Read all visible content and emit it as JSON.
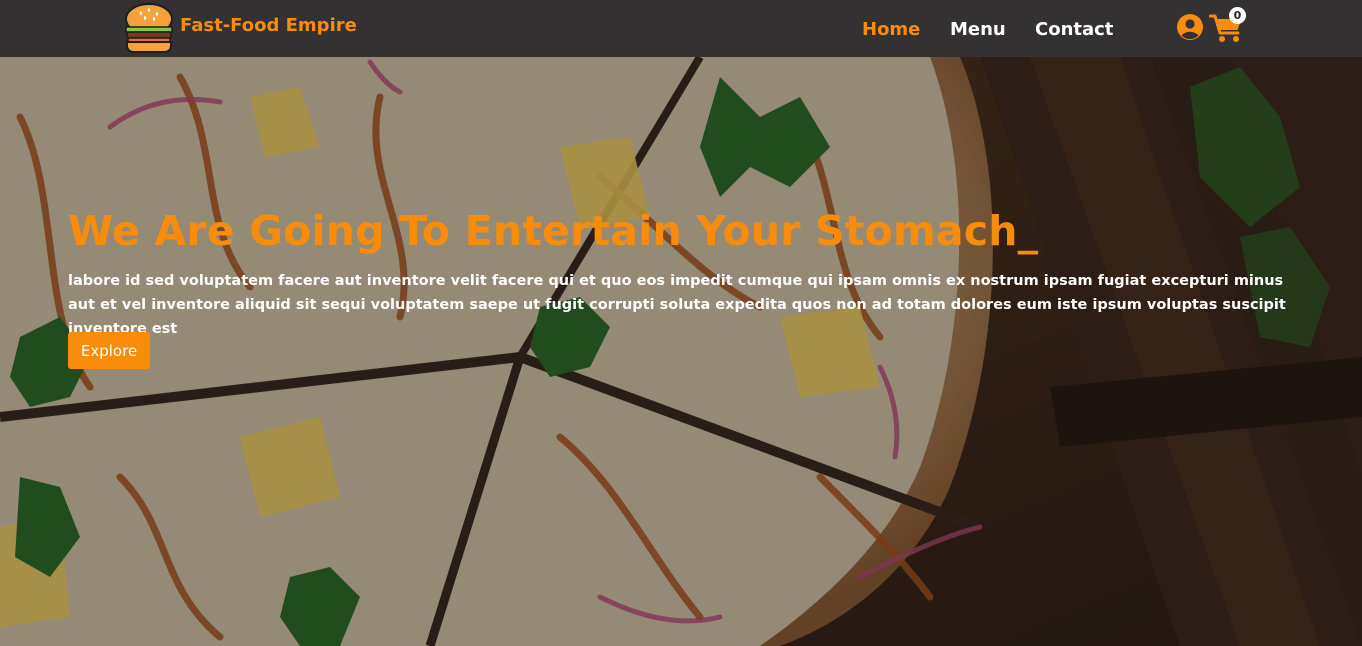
{
  "brand": {
    "name": "Fast-Food Empire",
    "logo_icon": "burger-icon"
  },
  "nav": {
    "items": [
      {
        "label": "Home",
        "active": true
      },
      {
        "label": "Menu",
        "active": false
      },
      {
        "label": "Contact",
        "active": false
      }
    ],
    "user_icon": "user-circle-icon",
    "cart_icon": "shopping-cart-icon",
    "cart_count": "0"
  },
  "hero": {
    "title": "We Are Going To Entertain Your Stomach_",
    "text": "labore id sed voluptatem facere aut inventore velit facere qui et quo eos impedit cumque qui ipsam omnis ex nostrum ipsam fugiat excepturi minus aut et vel inventore aliquid sit sequi voluptatem saepe ut fugit corrupti soluta expedita quos non ad totam dolores eum iste ipsum voluptas suscipit inventore est",
    "button_label": "Explore",
    "background": "pizza-photo"
  },
  "colors": {
    "accent": "#f98d0b",
    "navbar": "#333132",
    "text": "#ffffff"
  }
}
